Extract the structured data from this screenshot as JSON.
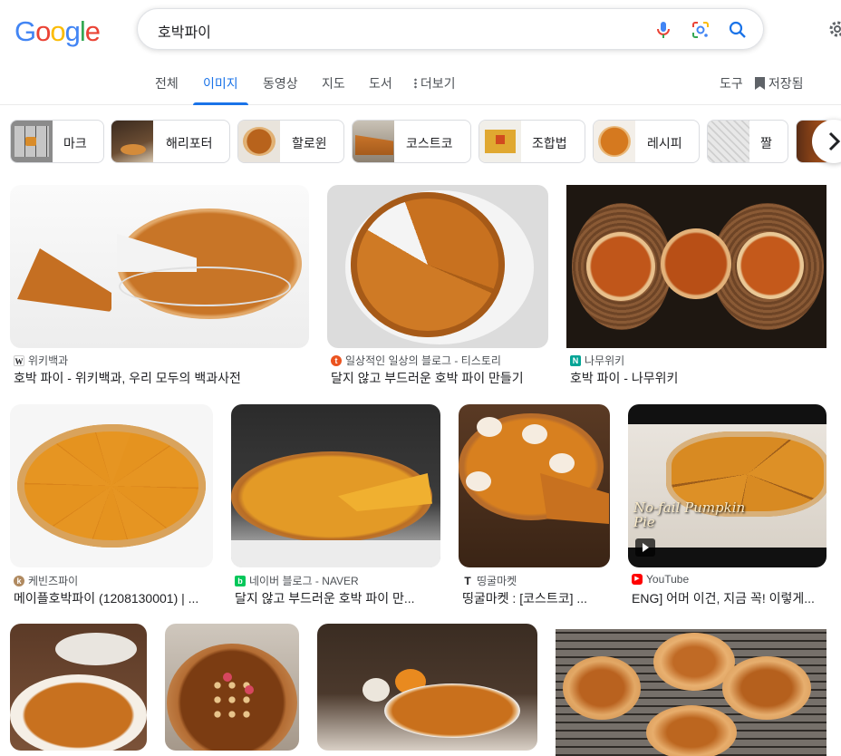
{
  "header": {
    "logo": [
      "G",
      "o",
      "o",
      "g",
      "l",
      "e"
    ],
    "logo_colors": [
      "#4285f4",
      "#ea4335",
      "#fbbc05",
      "#4285f4",
      "#34a853",
      "#ea4335"
    ],
    "search_query": "호박파이"
  },
  "tabs": [
    {
      "label": "전체"
    },
    {
      "label": "이미지"
    },
    {
      "label": "동영상"
    },
    {
      "label": "지도"
    },
    {
      "label": "도서"
    },
    {
      "label": "더보기"
    },
    {
      "label": "도구"
    },
    {
      "label": "저장됨"
    }
  ],
  "chips": [
    {
      "label": "마크"
    },
    {
      "label": "해리포터"
    },
    {
      "label": "할로윈"
    },
    {
      "label": "코스트코"
    },
    {
      "label": "조합법"
    },
    {
      "label": "레시피"
    },
    {
      "label": "짤"
    }
  ],
  "results": [
    {
      "source": "위키백과",
      "title": "호박 파이 - 위키백과, 우리 모두의 백과사전",
      "favicon": "W",
      "fav_color": "#202124",
      "fav_bg": "#fff"
    },
    {
      "source": "일상적인 일상의 블로그 - 티스토리",
      "title": "달지 않고 부드러운 호박 파이 만들기",
      "favicon": "t",
      "fav_color": "#fff",
      "fav_bg": "#eb531f"
    },
    {
      "source": "나무위키",
      "title": "호박 파이 - 나무위키",
      "favicon": "N",
      "fav_color": "#fff",
      "fav_bg": "#00a495"
    },
    {
      "source": "케빈즈파이",
      "title": "메이플호박파이 (1208130001) | ...",
      "favicon": "k",
      "fav_color": "#fff",
      "fav_bg": "#b08a60"
    },
    {
      "source": "네이버 블로그 - NAVER",
      "title": "달지 않고 부드러운 호박 파이 만...",
      "favicon": "b",
      "fav_color": "#fff",
      "fav_bg": "#03c75a"
    },
    {
      "source": "띵굴마켓",
      "title": "띵굴마켓 : [코스트코] ...",
      "favicon": "T",
      "fav_color": "#202124",
      "fav_bg": "#fff"
    },
    {
      "source": "YouTube",
      "title": "ENG] 어머 이건, 지금 꼭! 이렇게...",
      "favicon": "▶",
      "fav_color": "#fff",
      "fav_bg": "#ff0000"
    }
  ],
  "video_overlay_text": "No-fail Pumpkin Pie"
}
